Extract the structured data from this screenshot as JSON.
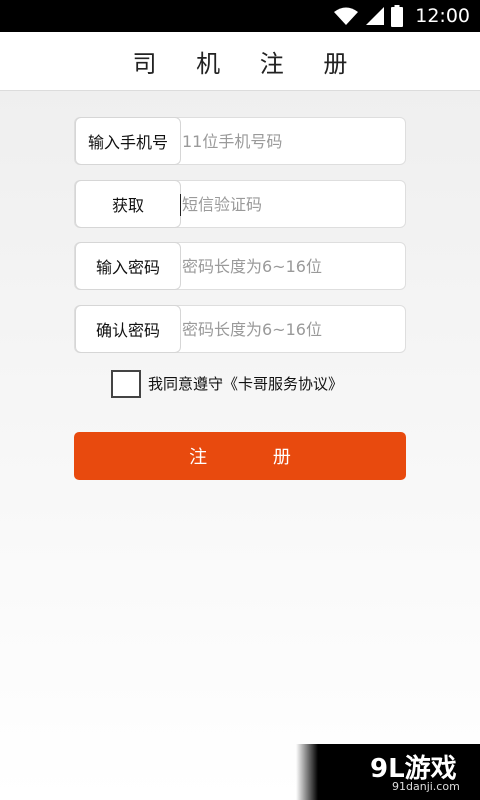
{
  "status_bar": {
    "time": "12:00",
    "icons": [
      "wifi-icon",
      "signal-icon",
      "battery-icon"
    ]
  },
  "header": {
    "title": "司 机 注 册"
  },
  "form": {
    "rows": [
      {
        "label": "输入手机号",
        "placeholder": "11位手机号码"
      },
      {
        "label": "获取",
        "placeholder": "短信验证码"
      },
      {
        "label": "输入密码",
        "placeholder": "密码长度为6~16位"
      },
      {
        "label": "确认密码",
        "placeholder": "密码长度为6~16位"
      }
    ],
    "agreement": "我同意遵守《卡哥服务协议》",
    "agreement_checked": false,
    "submit_label": "注 册"
  },
  "watermark": {
    "main": "9L游戏",
    "sub": "91danji.com"
  },
  "colors": {
    "accent": "#e84a0e",
    "status_bar": "#000000",
    "background_top": "#ededed"
  }
}
